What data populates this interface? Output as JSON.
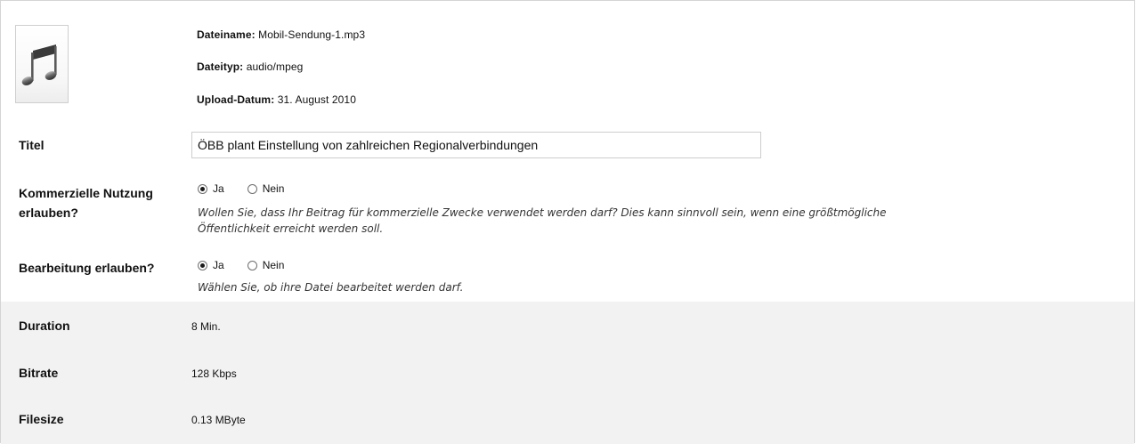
{
  "file": {
    "icon": "music-note-icon",
    "name_label": "Dateiname:",
    "name_value": "Mobil-Sendung-1.mp3",
    "type_label": "Dateityp:",
    "type_value": "audio/mpeg",
    "date_label": "Upload-Datum:",
    "date_value": "31. August 2010"
  },
  "form": {
    "title_label": "Titel",
    "title_value": "ÖBB plant Einstellung von zahlreichen Regionalverbindungen",
    "commercial": {
      "label_line1": "Kommerzielle Nutzung",
      "label_line2": "erlauben?",
      "option_yes": "Ja",
      "option_no": "Nein",
      "selected": "Ja",
      "hint_line1": "Wollen Sie, dass Ihr Beitrag für kommerzielle Zwecke verwendet werden darf? Dies kann sinnvoll sein, wenn eine größtmögliche",
      "hint_line2": "Öffentlichkeit erreicht werden soll."
    },
    "editing": {
      "label": "Bearbeitung erlauben?",
      "option_yes": "Ja",
      "option_no": "Nein",
      "selected": "Ja",
      "hint": "Wählen Sie, ob ihre Datei bearbeitet werden darf."
    }
  },
  "properties": {
    "duration_label": "Duration",
    "duration_value": "8 Min.",
    "bitrate_label": "Bitrate",
    "bitrate_value": "128 Kbps",
    "filesize_label": "Filesize",
    "filesize_value": "0.13 MByte"
  },
  "colors": {
    "border": "#d4d4d4",
    "properties_background": "#f2f2f2"
  }
}
